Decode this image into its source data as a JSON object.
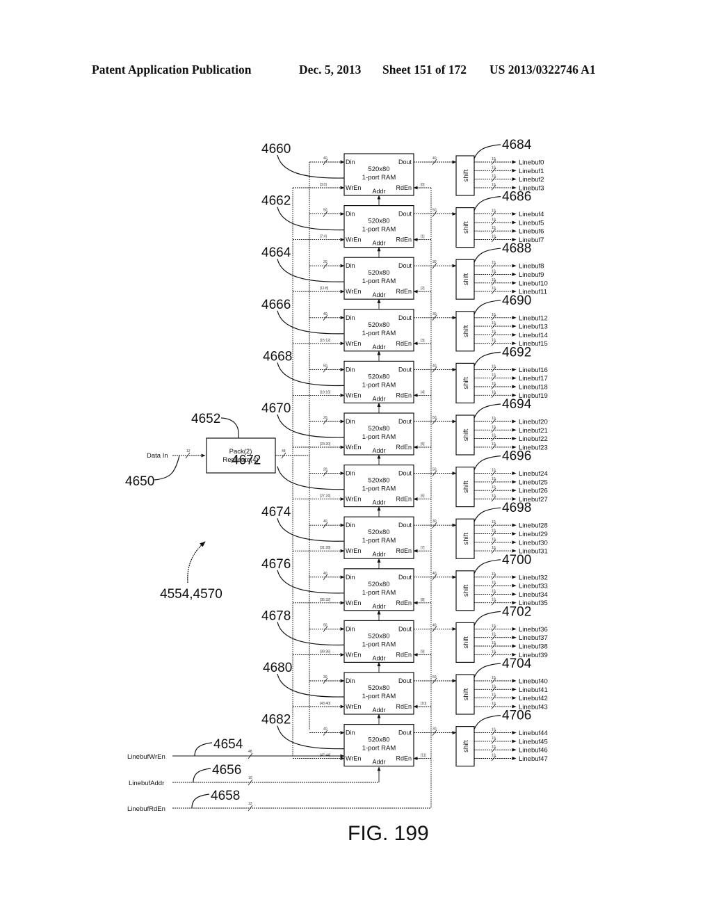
{
  "header": {
    "publication": "Patent Application Publication",
    "date": "Dec. 5, 2013",
    "sheet": "Sheet 151 of 172",
    "patent_number": "US 2013/0322746 A1"
  },
  "figure": {
    "caption": "FIG. 199",
    "assembly_ref": "4554,4570",
    "input": {
      "label": "Data In",
      "ref": "4650",
      "width": "12"
    },
    "pack_block": {
      "ref": "4652",
      "line1": "Pack(2)",
      "line2": "Replicate(4)",
      "out_width": "48"
    },
    "control_signals": [
      {
        "label": "LinebufWrEn",
        "ref": "4654",
        "width": "48"
      },
      {
        "label": "LinebufAddr",
        "ref": "4656",
        "width": "10"
      },
      {
        "label": "LinebufRdEn",
        "ref": "4658",
        "width": "12"
      }
    ],
    "ram_port_labels": {
      "din": "Din",
      "dout": "Dout",
      "wren": "WrEn",
      "rden": "RdEn",
      "addr": "Addr"
    },
    "ram_title_1": "520x80",
    "ram_title_2": "1-port RAM",
    "shift_label": "shift",
    "line_width": "10",
    "rams": [
      {
        "ref": "4660",
        "din_width": "40",
        "dout_width": "40",
        "wren_bits": "[3:0]",
        "rden_bit": "[0]",
        "shift_ref": "4684",
        "outputs": [
          "Linebuf0",
          "Linebuf1",
          "Linebuf2",
          "Linebuf3"
        ]
      },
      {
        "ref": "4662",
        "din_width": "50",
        "dout_width": "50",
        "wren_bits": "[7:4]",
        "rden_bit": "[1]",
        "shift_ref": "4686",
        "outputs": [
          "Linebuf4",
          "Linebuf5",
          "Linebuf6",
          "Linebuf7"
        ]
      },
      {
        "ref": "4664",
        "din_width": "20",
        "dout_width": "30",
        "wren_bits": "[11:8]",
        "rden_bit": "[2]",
        "shift_ref": "4688",
        "outputs": [
          "Linebuf8",
          "Linebuf9",
          "Linebuf10",
          "Linebuf11"
        ]
      },
      {
        "ref": "4666",
        "din_width": "40",
        "dout_width": "30",
        "wren_bits": "[15:12]",
        "rden_bit": "[3]",
        "shift_ref": "4690",
        "outputs": [
          "Linebuf12",
          "Linebuf13",
          "Linebuf14",
          "Linebuf15"
        ]
      },
      {
        "ref": "4668",
        "din_width": "50",
        "dout_width": "40",
        "wren_bits": "[19:16]",
        "rden_bit": "[4]",
        "shift_ref": "4692",
        "outputs": [
          "Linebuf16",
          "Linebuf17",
          "Linebuf18",
          "Linebuf19"
        ]
      },
      {
        "ref": "4670",
        "din_width": "20",
        "dout_width": "50",
        "wren_bits": "[23:20]",
        "rden_bit": "[5]",
        "shift_ref": "4694",
        "outputs": [
          "Linebuf20",
          "Linebuf21",
          "Linebuf22",
          "Linebuf23"
        ]
      },
      {
        "ref": "4672",
        "din_width": "20",
        "dout_width": "50",
        "wren_bits": "[27:24]",
        "rden_bit": "[6]",
        "shift_ref": "4696",
        "outputs": [
          "Linebuf24",
          "Linebuf25",
          "Linebuf26",
          "Linebuf27"
        ]
      },
      {
        "ref": "4674",
        "din_width": "40",
        "dout_width": "30",
        "wren_bits": "[31:28]",
        "rden_bit": "[7]",
        "shift_ref": "4698",
        "outputs": [
          "Linebuf28",
          "Linebuf29",
          "Linebuf30",
          "Linebuf31"
        ]
      },
      {
        "ref": "4676",
        "din_width": "40",
        "dout_width": "40",
        "wren_bits": "[35:32]",
        "rden_bit": "[8]",
        "shift_ref": "4700",
        "outputs": [
          "Linebuf32",
          "Linebuf33",
          "Linebuf34",
          "Linebuf35"
        ]
      },
      {
        "ref": "4678",
        "din_width": "50",
        "dout_width": "40",
        "wren_bits": "[39:36]",
        "rden_bit": "[9]",
        "shift_ref": "4702",
        "outputs": [
          "Linebuf36",
          "Linebuf37",
          "Linebuf38",
          "Linebuf39"
        ]
      },
      {
        "ref": "4680",
        "din_width": "30",
        "dout_width": "50",
        "wren_bits": "[43:40]",
        "rden_bit": "[10]",
        "shift_ref": "4704",
        "outputs": [
          "Linebuf40",
          "Linebuf41",
          "Linebuf42",
          "Linebuf43"
        ]
      },
      {
        "ref": "4682",
        "din_width": "40",
        "dout_width": "30",
        "wren_bits": "[47:44]",
        "rden_bit": "[11]",
        "shift_ref": "4706",
        "outputs": [
          "Linebuf44",
          "Linebuf45",
          "Linebuf46",
          "Linebuf47"
        ]
      }
    ]
  }
}
